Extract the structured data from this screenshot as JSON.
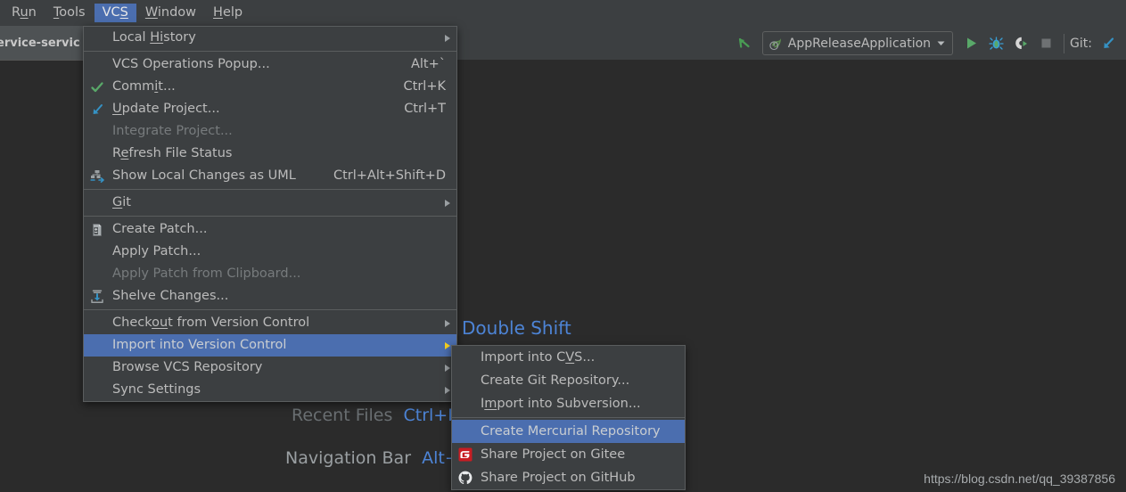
{
  "app": {
    "background_color": "#2b2b2b",
    "panel_color": "#3c3f41",
    "accent_color": "#4b6eaf",
    "text_color": "#bbbbbb"
  },
  "menubar": {
    "items": [
      {
        "label": "Run",
        "mnemonic": "u",
        "active": false
      },
      {
        "label": "Tools",
        "mnemonic": "T",
        "active": false
      },
      {
        "label": "VCS",
        "mnemonic": "S",
        "active": true
      },
      {
        "label": "Window",
        "mnemonic": "W",
        "active": false
      },
      {
        "label": "Help",
        "mnemonic": "H",
        "active": false
      }
    ]
  },
  "editor_tab": {
    "label": "ervice-servic"
  },
  "toolbar": {
    "back_icon": "arrow-up-left-icon",
    "run_config": {
      "icon": "spring-boot-leaf-icon",
      "label": "AppReleaseApplication",
      "dropdown_icon": "chevron-down-icon"
    },
    "run_label": "Run",
    "debug_label": "Debug",
    "coverage_label": "Run with Coverage",
    "stop_label": "Stop",
    "git_label": "Git:",
    "git_update_icon": "update-project-icon"
  },
  "hints": {
    "double_shift": "Double Shift",
    "recent_files_label": "Recent Files",
    "recent_files_key": "Ctrl+E",
    "navigation_bar_label": "Navigation Bar",
    "navigation_bar_key": "Alt+"
  },
  "watermark": "https://blog.csdn.net/qq_39387856",
  "vcs_menu": {
    "groups": [
      {
        "items": [
          {
            "label": "Local History",
            "accel": "",
            "icon": "",
            "submenu": true,
            "disabled": false,
            "selected": false
          }
        ]
      },
      {
        "items": [
          {
            "label": "VCS Operations Popup...",
            "accel": "Alt+`",
            "icon": "",
            "submenu": false,
            "disabled": false,
            "selected": false
          },
          {
            "label": "Commit...",
            "accel": "Ctrl+K",
            "icon": "check-icon",
            "submenu": false,
            "disabled": false,
            "selected": false
          },
          {
            "label": "Update Project...",
            "accel": "Ctrl+T",
            "icon": "update-project-icon",
            "submenu": false,
            "disabled": false,
            "selected": false
          },
          {
            "label": "Integrate Project...",
            "accel": "",
            "icon": "",
            "submenu": false,
            "disabled": true,
            "selected": false
          },
          {
            "label": "Refresh File Status",
            "accel": "",
            "icon": "",
            "submenu": false,
            "disabled": false,
            "selected": false
          },
          {
            "label": "Show Local Changes as UML",
            "accel": "Ctrl+Alt+Shift+D",
            "icon": "uml-diagram-icon",
            "submenu": false,
            "disabled": false,
            "selected": false
          }
        ]
      },
      {
        "items": [
          {
            "label": "Git",
            "accel": "",
            "icon": "",
            "submenu": true,
            "disabled": false,
            "selected": false
          }
        ]
      },
      {
        "items": [
          {
            "label": "Create Patch...",
            "accel": "",
            "icon": "create-patch-icon",
            "submenu": false,
            "disabled": false,
            "selected": false
          },
          {
            "label": "Apply Patch...",
            "accel": "",
            "icon": "",
            "submenu": false,
            "disabled": false,
            "selected": false
          },
          {
            "label": "Apply Patch from Clipboard...",
            "accel": "",
            "icon": "",
            "submenu": false,
            "disabled": true,
            "selected": false
          },
          {
            "label": "Shelve Changes...",
            "accel": "",
            "icon": "shelve-changes-icon",
            "submenu": false,
            "disabled": false,
            "selected": false
          }
        ]
      },
      {
        "items": [
          {
            "label": "Checkout from Version Control",
            "accel": "",
            "icon": "",
            "submenu": true,
            "disabled": false,
            "selected": false
          },
          {
            "label": "Import into Version Control",
            "accel": "",
            "icon": "",
            "submenu": true,
            "disabled": false,
            "selected": true
          },
          {
            "label": "Browse VCS Repository",
            "accel": "",
            "icon": "",
            "submenu": true,
            "disabled": false,
            "selected": false
          },
          {
            "label": "Sync Settings",
            "accel": "",
            "icon": "",
            "submenu": true,
            "disabled": false,
            "selected": false
          }
        ]
      }
    ]
  },
  "import_submenu": {
    "groups": [
      {
        "items": [
          {
            "label": "Import into CVS...",
            "icon": "",
            "disabled": false,
            "selected": false
          },
          {
            "label": "Create Git Repository...",
            "icon": "",
            "disabled": false,
            "selected": false
          },
          {
            "label": "Import into Subversion...",
            "icon": "",
            "disabled": false,
            "selected": false
          }
        ]
      },
      {
        "items": [
          {
            "label": "Create Mercurial Repository",
            "icon": "",
            "disabled": false,
            "selected": true
          },
          {
            "label": "Share Project on Gitee",
            "icon": "gitee-icon",
            "disabled": false,
            "selected": false
          },
          {
            "label": "Share Project on GitHub",
            "icon": "github-icon",
            "disabled": false,
            "selected": false
          }
        ]
      }
    ]
  }
}
